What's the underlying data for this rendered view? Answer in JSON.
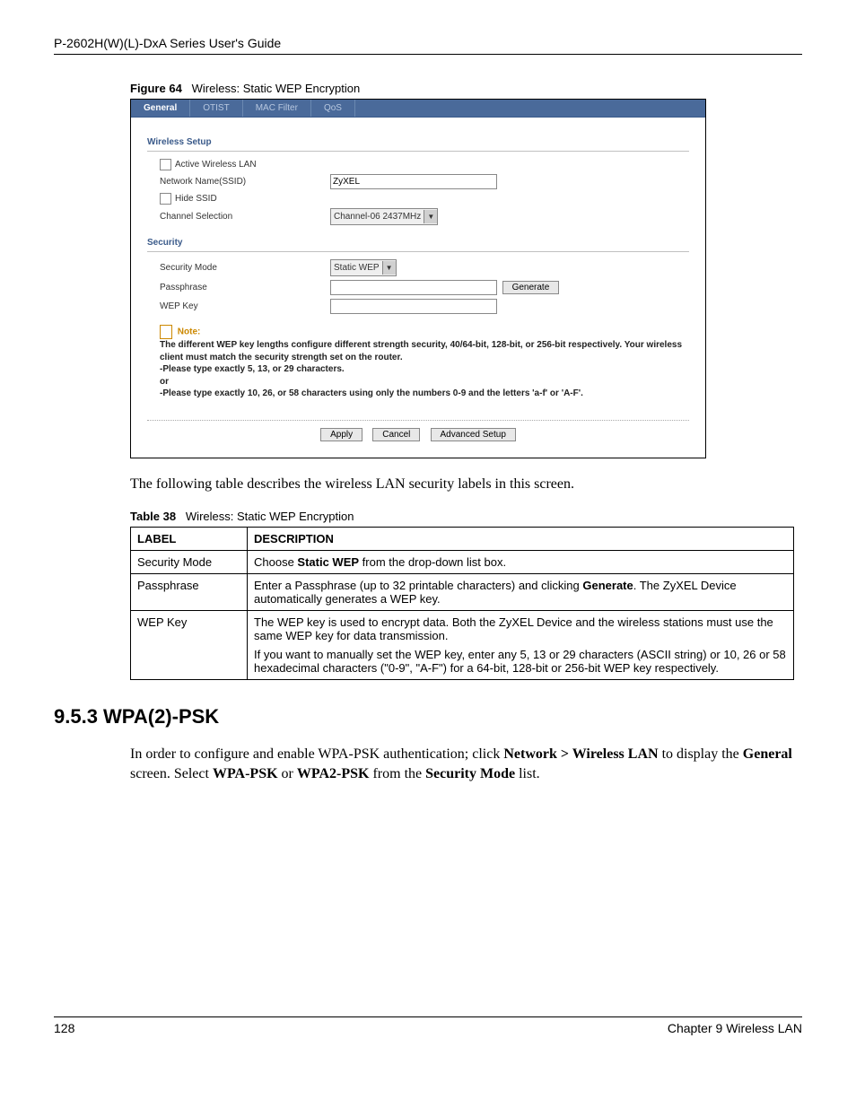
{
  "header_guide": "P-2602H(W)(L)-DxA Series User's Guide",
  "figure": {
    "label": "Figure 64",
    "title": "Wireless: Static WEP Encryption"
  },
  "ui": {
    "tabs": [
      "General",
      "OTIST",
      "MAC Filter",
      "QoS"
    ],
    "active_tab": "General",
    "wireless_setup_hdr": "Wireless Setup",
    "active_wlan": "Active Wireless LAN",
    "ssid_label": "Network Name(SSID)",
    "ssid_value": "ZyXEL",
    "hide_ssid": "Hide SSID",
    "channel_label": "Channel Selection",
    "channel_value": "Channel-06 2437MHz",
    "security_hdr": "Security",
    "sec_mode_label": "Security Mode",
    "sec_mode_value": "Static WEP",
    "passphrase_label": "Passphrase",
    "generate_btn": "Generate",
    "wep_key_label": "WEP Key",
    "note_label": "Note:",
    "note_line1": "The different WEP key lengths configure different strength security, 40/64-bit, 128-bit, or 256-bit respectively. Your wireless client must match the security strength set on the router.",
    "note_line2": "-Please type exactly 5, 13, or 29 characters.",
    "note_line3": "or",
    "note_line4": "-Please type exactly 10, 26, or 58 characters using only the numbers 0-9 and the letters 'a-f' or 'A-F'.",
    "apply_btn": "Apply",
    "cancel_btn": "Cancel",
    "adv_btn": "Advanced Setup"
  },
  "para1": "The following table describes the wireless LAN security labels in this screen.",
  "table_caption": {
    "label": "Table 38",
    "title": "Wireless: Static WEP Encryption"
  },
  "table": {
    "head": [
      "LABEL",
      "DESCRIPTION"
    ],
    "rows": [
      {
        "label": "Security Mode",
        "desc": [
          {
            "pre": "Choose ",
            "bold": "Static WEP",
            "post": " from the drop-down list box."
          }
        ]
      },
      {
        "label": "Passphrase",
        "desc": [
          {
            "pre": "Enter a Passphrase (up to 32 printable characters) and clicking ",
            "bold": "Generate",
            "post": ". The ZyXEL Device automatically generates a WEP key."
          }
        ]
      },
      {
        "label": "WEP Key",
        "desc": [
          {
            "pre": "The WEP key is used to encrypt data. Both the ZyXEL Device and the wireless stations must use the same WEP key for data transmission.",
            "bold": "",
            "post": ""
          },
          {
            "pre": "If you want to manually set the WEP key, enter any 5, 13 or 29 characters (ASCII string) or 10, 26 or 58 hexadecimal characters (\"0-9\", \"A-F\") for a 64-bit, 128-bit or 256-bit WEP key respectively.",
            "bold": "",
            "post": ""
          }
        ]
      }
    ]
  },
  "section_heading": "9.5.3  WPA(2)-PSK",
  "para2_parts": {
    "p1": "In order to configure and enable WPA-PSK authentication; click ",
    "b1": "Network > Wireless LAN",
    "p2": " to display the ",
    "b2": "General",
    "p3": " screen. Select ",
    "b3": "WPA-PSK",
    "p4": " or ",
    "b4": "WPA2-PSK",
    "p5": " from the ",
    "b5": "Security Mode",
    "p6": " list."
  },
  "footer": {
    "page": "128",
    "chapter": "Chapter 9 Wireless LAN"
  }
}
